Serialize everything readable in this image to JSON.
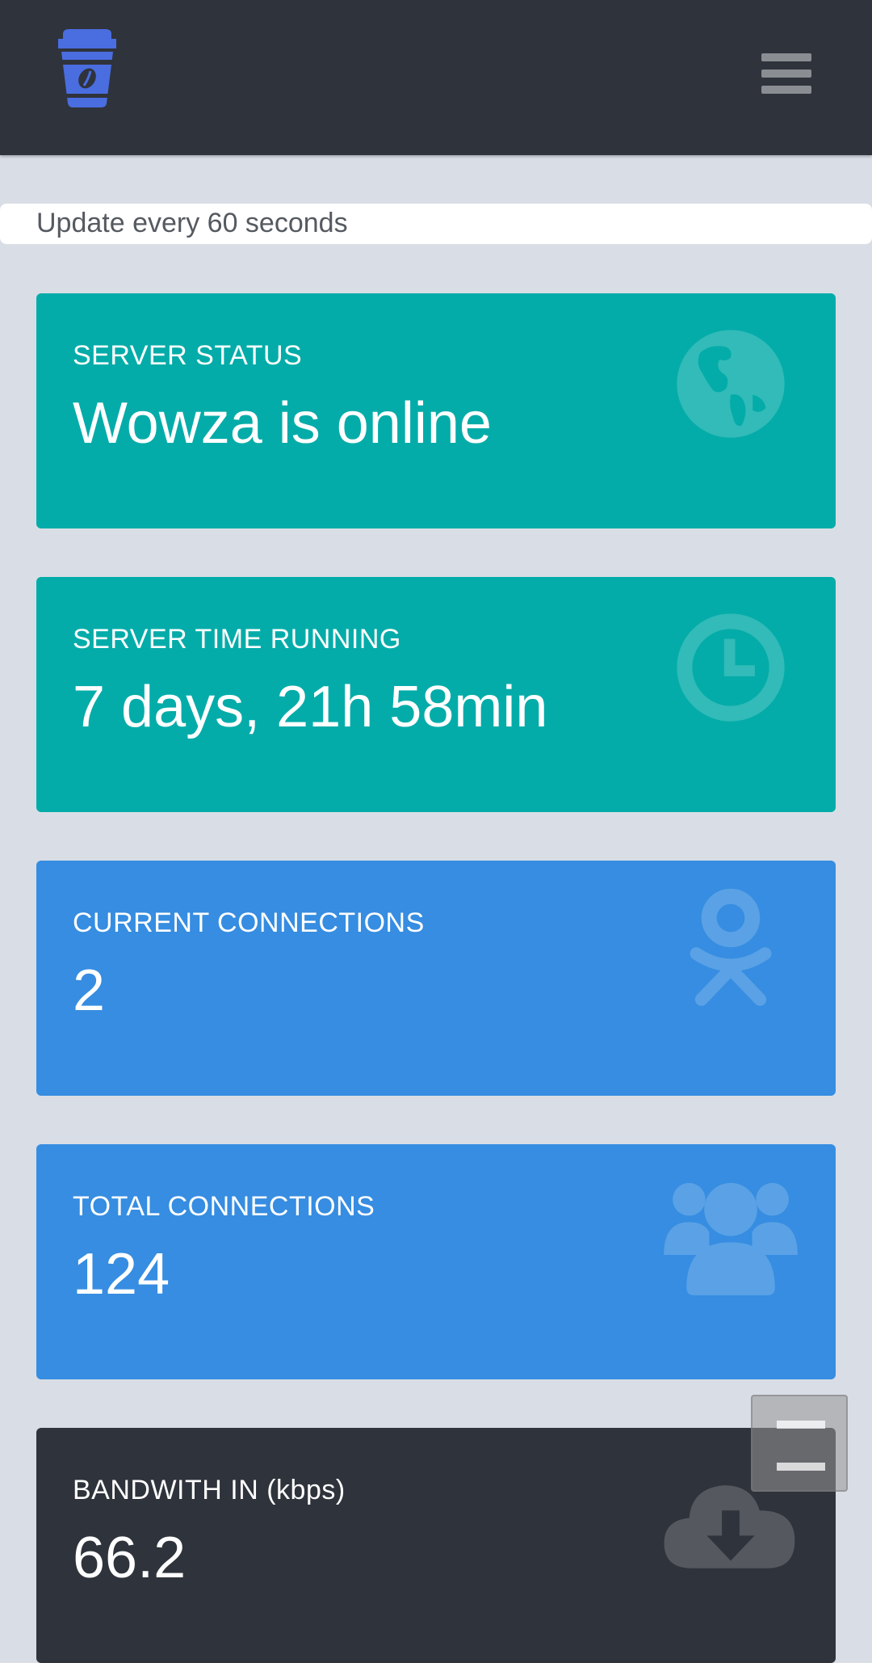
{
  "header": {
    "logo_icon": "coffee-cup-icon",
    "menu_icon": "hamburger-menu-icon"
  },
  "update_text": "Update every 60 seconds",
  "cards": [
    {
      "label": "SERVER STATUS",
      "value": "Wowza is online",
      "icon": "globe-icon",
      "color": "#04aca9"
    },
    {
      "label": "SERVER TIME RUNNING",
      "value": "7 days, 21h 58min",
      "icon": "clock-icon",
      "color": "#04aca9"
    },
    {
      "label": "CURRENT CONNECTIONS",
      "value": "2",
      "icon": "odnoklassniki-icon",
      "color": "#368de1"
    },
    {
      "label": "TOTAL CONNECTIONS",
      "value": "124",
      "icon": "users-icon",
      "color": "#368de1"
    },
    {
      "label": "BANDWITH IN (kbps)",
      "value": "66.2",
      "icon": "cloud-download-icon",
      "color": "#2f333b"
    }
  ],
  "colors": {
    "header_bg": "#2f333b",
    "page_bg": "#d9dee6",
    "logo": "#4a6de0",
    "teal": "#04aca9",
    "blue": "#368de1"
  }
}
